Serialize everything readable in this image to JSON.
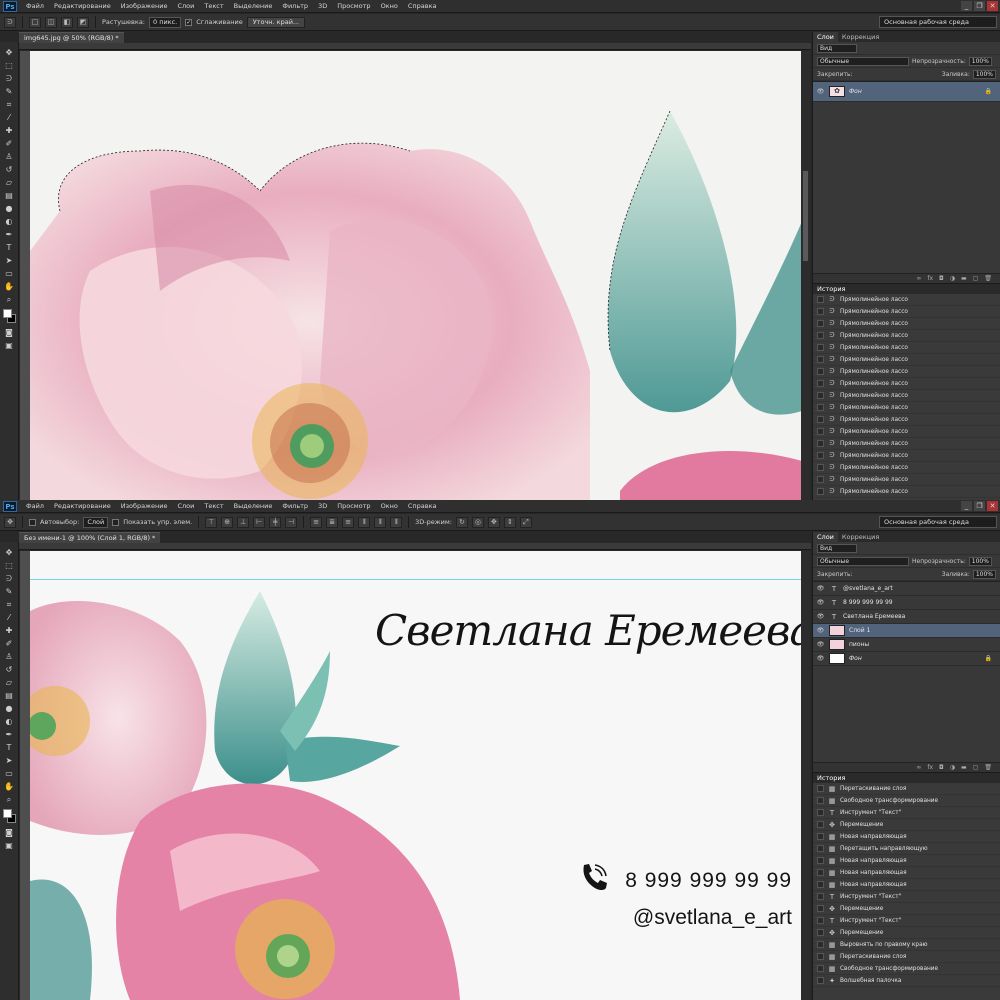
{
  "ps1": {
    "menu": [
      "Файл",
      "Редактирование",
      "Изображение",
      "Слои",
      "Текст",
      "Выделение",
      "Фильтр",
      "3D",
      "Просмотр",
      "Окно",
      "Справка"
    ],
    "options": {
      "feather_label": "Растушевка:",
      "feather_value": "0 пикс.",
      "antialias_label": "Сглаживание",
      "refine_button": "Уточн. край...",
      "workspace": "Основная рабочая среда"
    },
    "doc_tab": "img645.jpg @ 50% (RGB/8) *",
    "panel": {
      "tabs": [
        "Слои",
        "Коррекция"
      ],
      "kind_filter": "Вид",
      "blend_mode": "Обычные",
      "opacity_label": "Непрозрачность:",
      "opacity_value": "100%",
      "lock_label": "Закрепить:",
      "fill_label": "Заливка:",
      "fill_value": "100%",
      "layers": [
        {
          "name": "Фон",
          "locked": true
        }
      ],
      "history_title": "История",
      "history": [
        {
          "icon": "lasso-icon",
          "label": "Прямолинейное лассо"
        },
        {
          "icon": "lasso-icon",
          "label": "Прямолинейное лассо"
        },
        {
          "icon": "lasso-icon",
          "label": "Прямолинейное лассо"
        },
        {
          "icon": "lasso-icon",
          "label": "Прямолинейное лассо"
        },
        {
          "icon": "lasso-icon",
          "label": "Прямолинейное лассо"
        },
        {
          "icon": "lasso-icon",
          "label": "Прямолинейное лассо"
        },
        {
          "icon": "lasso-icon",
          "label": "Прямолинейное лассо"
        },
        {
          "icon": "lasso-icon",
          "label": "Прямолинейное лассо"
        },
        {
          "icon": "lasso-icon",
          "label": "Прямолинейное лассо"
        },
        {
          "icon": "lasso-icon",
          "label": "Прямолинейное лассо"
        },
        {
          "icon": "lasso-icon",
          "label": "Прямолинейное лассо"
        },
        {
          "icon": "lasso-icon",
          "label": "Прямолинейное лассо"
        },
        {
          "icon": "lasso-icon",
          "label": "Прямолинейное лассо"
        },
        {
          "icon": "lasso-icon",
          "label": "Прямолинейное лассо"
        },
        {
          "icon": "lasso-icon",
          "label": "Прямолинейное лассо"
        },
        {
          "icon": "lasso-icon",
          "label": "Прямолинейное лассо"
        },
        {
          "icon": "lasso-icon",
          "label": "Прямолинейное лассо"
        }
      ]
    }
  },
  "ps2": {
    "menu": [
      "Файл",
      "Редактирование",
      "Изображение",
      "Слои",
      "Текст",
      "Выделение",
      "Фильтр",
      "3D",
      "Просмотр",
      "Окно",
      "Справка"
    ],
    "options": {
      "autoselect_label": "Автовыбор:",
      "autoselect_value": "Слой",
      "show_controls_label": "Показать упр. элем.",
      "mode3d_label": "3D-режим:",
      "workspace": "Основная рабочая среда"
    },
    "doc_tab": "Без имени-1 @ 100% (Слой 1, RGB/8) *",
    "panel": {
      "tabs": [
        "Слои",
        "Коррекция"
      ],
      "kind_filter": "Вид",
      "blend_mode": "Обычные",
      "opacity_label": "Непрозрачность:",
      "opacity_value": "100%",
      "lock_label": "Закрепить:",
      "fill_label": "Заливка:",
      "fill_value": "100%",
      "layers": [
        {
          "type": "text",
          "name": "@svetlana_e_art"
        },
        {
          "type": "text",
          "name": "8 999 999 99 99"
        },
        {
          "type": "text",
          "name": "Светлана Еремеева"
        },
        {
          "type": "image",
          "name": "Слой 1",
          "selected": true
        },
        {
          "type": "image",
          "name": "пионы"
        },
        {
          "type": "fill",
          "name": "Фон",
          "locked": true
        }
      ],
      "history_title": "История",
      "history": [
        {
          "icon": "layer-icon",
          "label": "Перетаскивание слоя"
        },
        {
          "icon": "layer-icon",
          "label": "Свободное трансформирование"
        },
        {
          "icon": "text-icon",
          "label": "Инструмент \"Текст\""
        },
        {
          "icon": "move-icon",
          "label": "Перемещение"
        },
        {
          "icon": "layer-icon",
          "label": "Новая направляющая"
        },
        {
          "icon": "layer-icon",
          "label": "Перетащить направляющую"
        },
        {
          "icon": "layer-icon",
          "label": "Новая направляющая"
        },
        {
          "icon": "layer-icon",
          "label": "Новая направляющая"
        },
        {
          "icon": "layer-icon",
          "label": "Новая направляющая"
        },
        {
          "icon": "text-icon",
          "label": "Инструмент \"Текст\""
        },
        {
          "icon": "move-icon",
          "label": "Перемещение"
        },
        {
          "icon": "text-icon",
          "label": "Инструмент \"Текст\""
        },
        {
          "icon": "move-icon",
          "label": "Перемещение"
        },
        {
          "icon": "layer-icon",
          "label": "Выровнять по правому краю"
        },
        {
          "icon": "layer-icon",
          "label": "Перетаскивание слоя"
        },
        {
          "icon": "layer-icon",
          "label": "Свободное трансформирование"
        },
        {
          "icon": "wand-icon",
          "label": "Волшебная палочка"
        }
      ]
    },
    "card": {
      "name": "Светлана Еремеева",
      "phone": "8 999 999 99 99",
      "instagram": "@svetlana_e_art"
    }
  },
  "colors": {
    "accent": "#51647c",
    "guide": "#6fd7e6",
    "pink": "#e79bb5",
    "teal": "#4f9e98"
  }
}
